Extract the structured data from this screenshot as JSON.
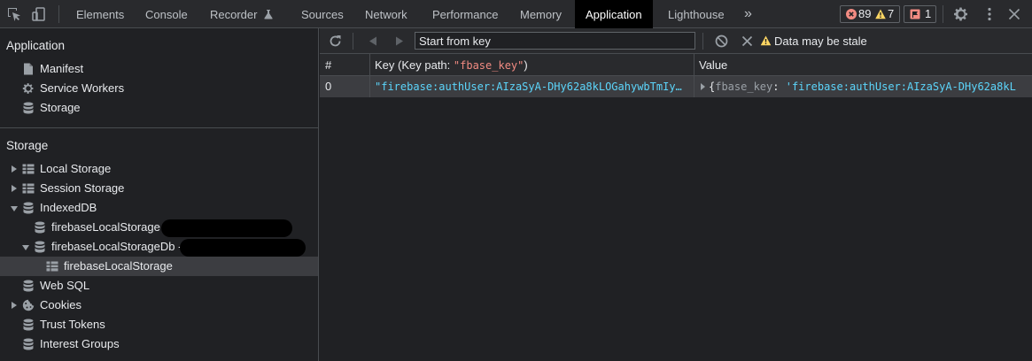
{
  "tabs": [
    {
      "label": "Elements"
    },
    {
      "label": "Console"
    },
    {
      "label": "Recorder"
    },
    {
      "label": "Sources"
    },
    {
      "label": "Network"
    },
    {
      "label": "Performance"
    },
    {
      "label": "Memory"
    },
    {
      "label": "Application"
    },
    {
      "label": "Lighthouse"
    }
  ],
  "more_tabs": "»",
  "badges": {
    "errors": "89",
    "warnings": "7",
    "issues": "1"
  },
  "sidebar": {
    "application_title": "Application",
    "application_items": [
      {
        "label": "Manifest",
        "icon": "file-icon"
      },
      {
        "label": "Service Workers",
        "icon": "gear-icon"
      },
      {
        "label": "Storage",
        "icon": "database-icon"
      }
    ],
    "storage_title": "Storage",
    "storage_items": [
      {
        "label": "Local Storage"
      },
      {
        "label": "Session Storage"
      },
      {
        "label": "IndexedDB"
      },
      {
        "label": "firebaseLocalStorage"
      },
      {
        "label": "firebaseLocalStorageDb -"
      },
      {
        "label": "firebaseLocalStorage"
      },
      {
        "label": "Web SQL"
      },
      {
        "label": "Cookies"
      },
      {
        "label": "Trust Tokens"
      },
      {
        "label": "Interest Groups"
      }
    ]
  },
  "toolbar": {
    "key_placeholder": "Start from key",
    "stale_text": "Data may be stale"
  },
  "table": {
    "headers": {
      "index": "#",
      "key_prefix": "Key (Key path: ",
      "key_path": "\"fbase_key\"",
      "key_suffix": ")",
      "value": "Value"
    },
    "rows": [
      {
        "index": "0",
        "key": "\"firebase:authUser:AIzaSyA-DHy62a8kLOGahywbTmIy…",
        "value_open": "{",
        "value_prop": "fbase_key",
        "value_colon": ": ",
        "value_str": "'firebase:authUser:AIzaSyA-DHy62a8kL"
      }
    ]
  },
  "colors": {
    "accent": "#8ab4f8",
    "string": "#5cd5fb",
    "key_path": "#f28b82",
    "error": "#f28b82",
    "warning": "#fdd663"
  }
}
